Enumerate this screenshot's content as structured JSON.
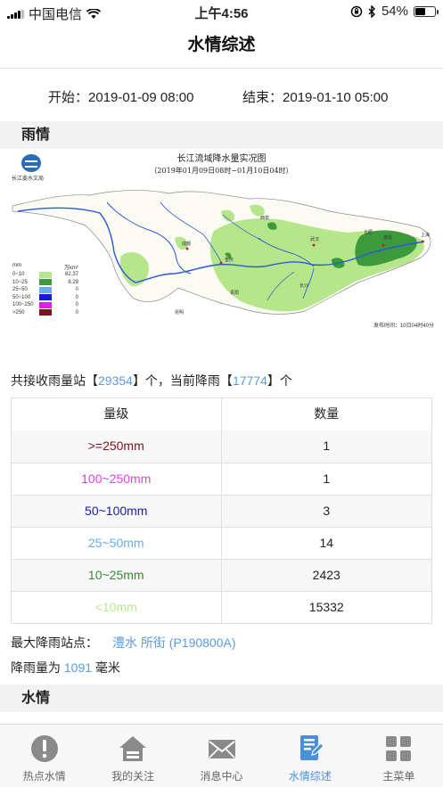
{
  "status_bar": {
    "carrier": "中国电信",
    "time": "上午4:56",
    "battery": "54%"
  },
  "nav": {
    "title": "水情综述"
  },
  "time_range": {
    "start_label": "开始：",
    "start": "2019-01-09 08:00",
    "end_label": "结束：",
    "end": "2019-01-10 05:00"
  },
  "rain_section": {
    "title": "雨情"
  },
  "map": {
    "title": "长江流域降水量实况图",
    "subtitle": "（2019年01月09日08时~01月10日04时）",
    "agency": "长江委水文局",
    "legend_header_mm": "mm",
    "legend_header_area": "万km²",
    "legend": [
      {
        "range": "0~10",
        "color": "#b6e68a",
        "count": "82.37"
      },
      {
        "range": "10~25",
        "color": "#3c9a3c",
        "count": "8.29"
      },
      {
        "range": "25~50",
        "color": "#6aaee8",
        "count": "0"
      },
      {
        "range": "50~100",
        "color": "#1a1acc",
        "count": "0"
      },
      {
        "range": "100~250",
        "color": "#e020e0",
        "count": "0"
      },
      {
        "range": ">250",
        "color": "#7a1520",
        "count": "0"
      }
    ],
    "publish": "发布时间：10日04时40分",
    "place_labels": {
      "chengdu": "成都",
      "chongqing": "重庆",
      "wuhan": "武汉",
      "nanjing": "南京",
      "shanghai": "上海",
      "hefei": "合肥",
      "xian": "西安",
      "changsha": "长沙",
      "guiyang": "贵阳",
      "kunming": "昆明"
    }
  },
  "stats": {
    "prefix": "共接收雨量站【",
    "total": "29354",
    "middle": "】个，当前降雨【",
    "raining": "17774",
    "suffix": "】个"
  },
  "table": {
    "headers": [
      "量级",
      "数量"
    ],
    "rows": [
      {
        "level": ">=250mm",
        "color": "#7a1520",
        "count": "1"
      },
      {
        "level": "100~250mm",
        "color": "#e040e0",
        "count": "1"
      },
      {
        "level": "50~100mm",
        "color": "#1a1aa8",
        "count": "3"
      },
      {
        "level": "25~50mm",
        "color": "#6aaee8",
        "count": "14"
      },
      {
        "level": "10~25mm",
        "color": "#3a8a3a",
        "count": "2423"
      },
      {
        "level": "<10mm",
        "color": "#b8e890",
        "count": "15332"
      }
    ]
  },
  "max_station": {
    "label": "最大降雨站点：",
    "station": "澧水 所街 (P190800A)"
  },
  "rainfall": {
    "prefix": "降雨量为 ",
    "value": "1091",
    "suffix": " 毫米"
  },
  "water_section": {
    "title": "水情"
  },
  "tabs": [
    {
      "label": "热点水情",
      "icon": "alert-icon"
    },
    {
      "label": "我的关注",
      "icon": "home-icon"
    },
    {
      "label": "消息中心",
      "icon": "mail-icon"
    },
    {
      "label": "水情综述",
      "icon": "document-icon",
      "active": true
    },
    {
      "label": "主菜单",
      "icon": "grid-icon"
    }
  ]
}
